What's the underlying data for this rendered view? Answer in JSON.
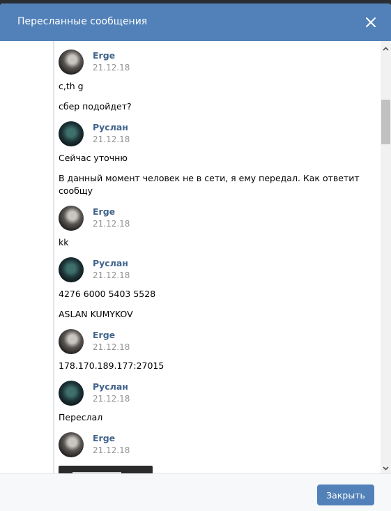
{
  "modal": {
    "title": "Пересланные сообщения",
    "close_button_label": "Закрыть"
  },
  "messages": [
    {
      "author": "Erge",
      "date": "21.12.18",
      "avatar": "erge",
      "texts": [
        "c,th g",
        "сбер подойдет?"
      ]
    },
    {
      "author": "Руслан",
      "date": "21.12.18",
      "avatar": "ruslan",
      "texts": [
        "Сейчас уточню",
        "В данный момент человек не в сети, я ему передал. Как ответит сообщу"
      ]
    },
    {
      "author": "Erge",
      "date": "21.12.18",
      "avatar": "erge",
      "texts": [
        "kk"
      ]
    },
    {
      "author": "Руслан",
      "date": "21.12.18",
      "avatar": "ruslan",
      "texts": [
        "4276 6000 5403 5528",
        "ASLAN KUMYKOV"
      ]
    },
    {
      "author": "Erge",
      "date": "21.12.18",
      "avatar": "erge",
      "texts": [
        "178.170.189.177:27015"
      ]
    },
    {
      "author": "Руслан",
      "date": "21.12.18",
      "avatar": "ruslan",
      "texts": [
        "Переслал"
      ]
    },
    {
      "author": "Erge",
      "date": "21.12.18",
      "avatar": "erge",
      "texts": [],
      "attachment": "screenshot-image"
    }
  ],
  "colors": {
    "header": "#5181b8",
    "author_name": "#42648b",
    "date": "#939393"
  }
}
